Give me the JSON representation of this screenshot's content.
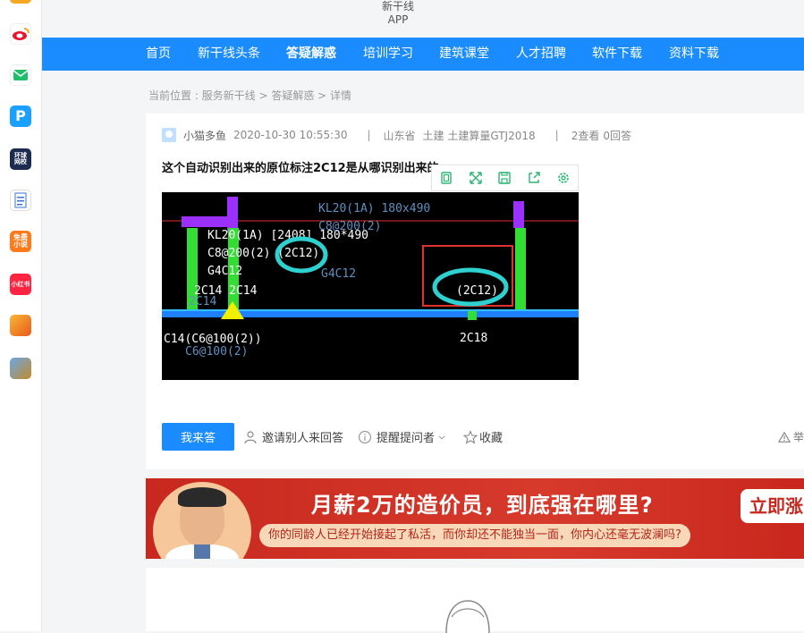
{
  "dock": {
    "icons": [
      {
        "name": "weibo-icon",
        "label": "",
        "color": "#f5a623"
      },
      {
        "name": "mail-icon",
        "label": "",
        "color": "#1fbf6a"
      },
      {
        "name": "p-app-icon",
        "label": "P",
        "color": "#1aa0ff"
      },
      {
        "name": "huanqiu-icon",
        "label": "环球\n网校",
        "color": "#1c2b50"
      },
      {
        "name": "document-icon",
        "label": "W",
        "color": "#3b74d8"
      },
      {
        "name": "free-novel-icon",
        "label": "免费\n小说",
        "color": "#ff7a1a"
      },
      {
        "name": "xiaohongshu-icon",
        "label": "小红书",
        "color": "#ff2442"
      },
      {
        "name": "game-icon",
        "label": "",
        "color": "#e85a1d"
      },
      {
        "name": "game2-icon",
        "label": "",
        "color": "#c48a2a"
      }
    ]
  },
  "header": {
    "app_line1": "新干线",
    "app_line2": "APP"
  },
  "nav": {
    "items": [
      "首页",
      "新干线头条",
      "答疑解惑",
      "培训学习",
      "建筑课堂",
      "人才招聘",
      "软件下载",
      "资料下载"
    ],
    "active_index": 2
  },
  "breadcrumb": {
    "text": "当前位置 : 服务新干线 > 答疑解惑 > 详情"
  },
  "question": {
    "author": "小猫多鱼",
    "datetime": "2020-10-30 10:55:30",
    "region": "山东省",
    "category": "土建 土建算量GTJ2018",
    "views": "2查看",
    "answers": "0回答",
    "title": "这个自动识别出来的原位标注2C12是从哪识别出来的"
  },
  "cad_text": {
    "beam_label": "KL20(1A) 180x490",
    "beam_label2": "C8@200(2)",
    "l1": "KL20(1A) [2408] 180*490",
    "l2": "C8@200(2) (2C12)",
    "l3": "G4C12",
    "l4": "2C14  2C14",
    "l5": "C14(C6@100(2))",
    "l6": "C6@100(2)",
    "circled": "(2C12)",
    "g4": "G4C12",
    "c18": "2C18",
    "l4a": "2C14"
  },
  "actions": {
    "answer_btn": "我来答",
    "invite": "邀请别人来回答",
    "remind": "提醒提问者",
    "favorite": "收藏",
    "report": "举"
  },
  "banner": {
    "headline": "月薪2万的造价员，到底强在哪里?",
    "sub": "你的同龄人已经开始接起了私活，而你却还不能独当一面，你内心还毫无波澜吗?",
    "cta": "立即涨"
  },
  "colors": {
    "primary": "#1a8cff",
    "banner_red": "#c8281e"
  }
}
